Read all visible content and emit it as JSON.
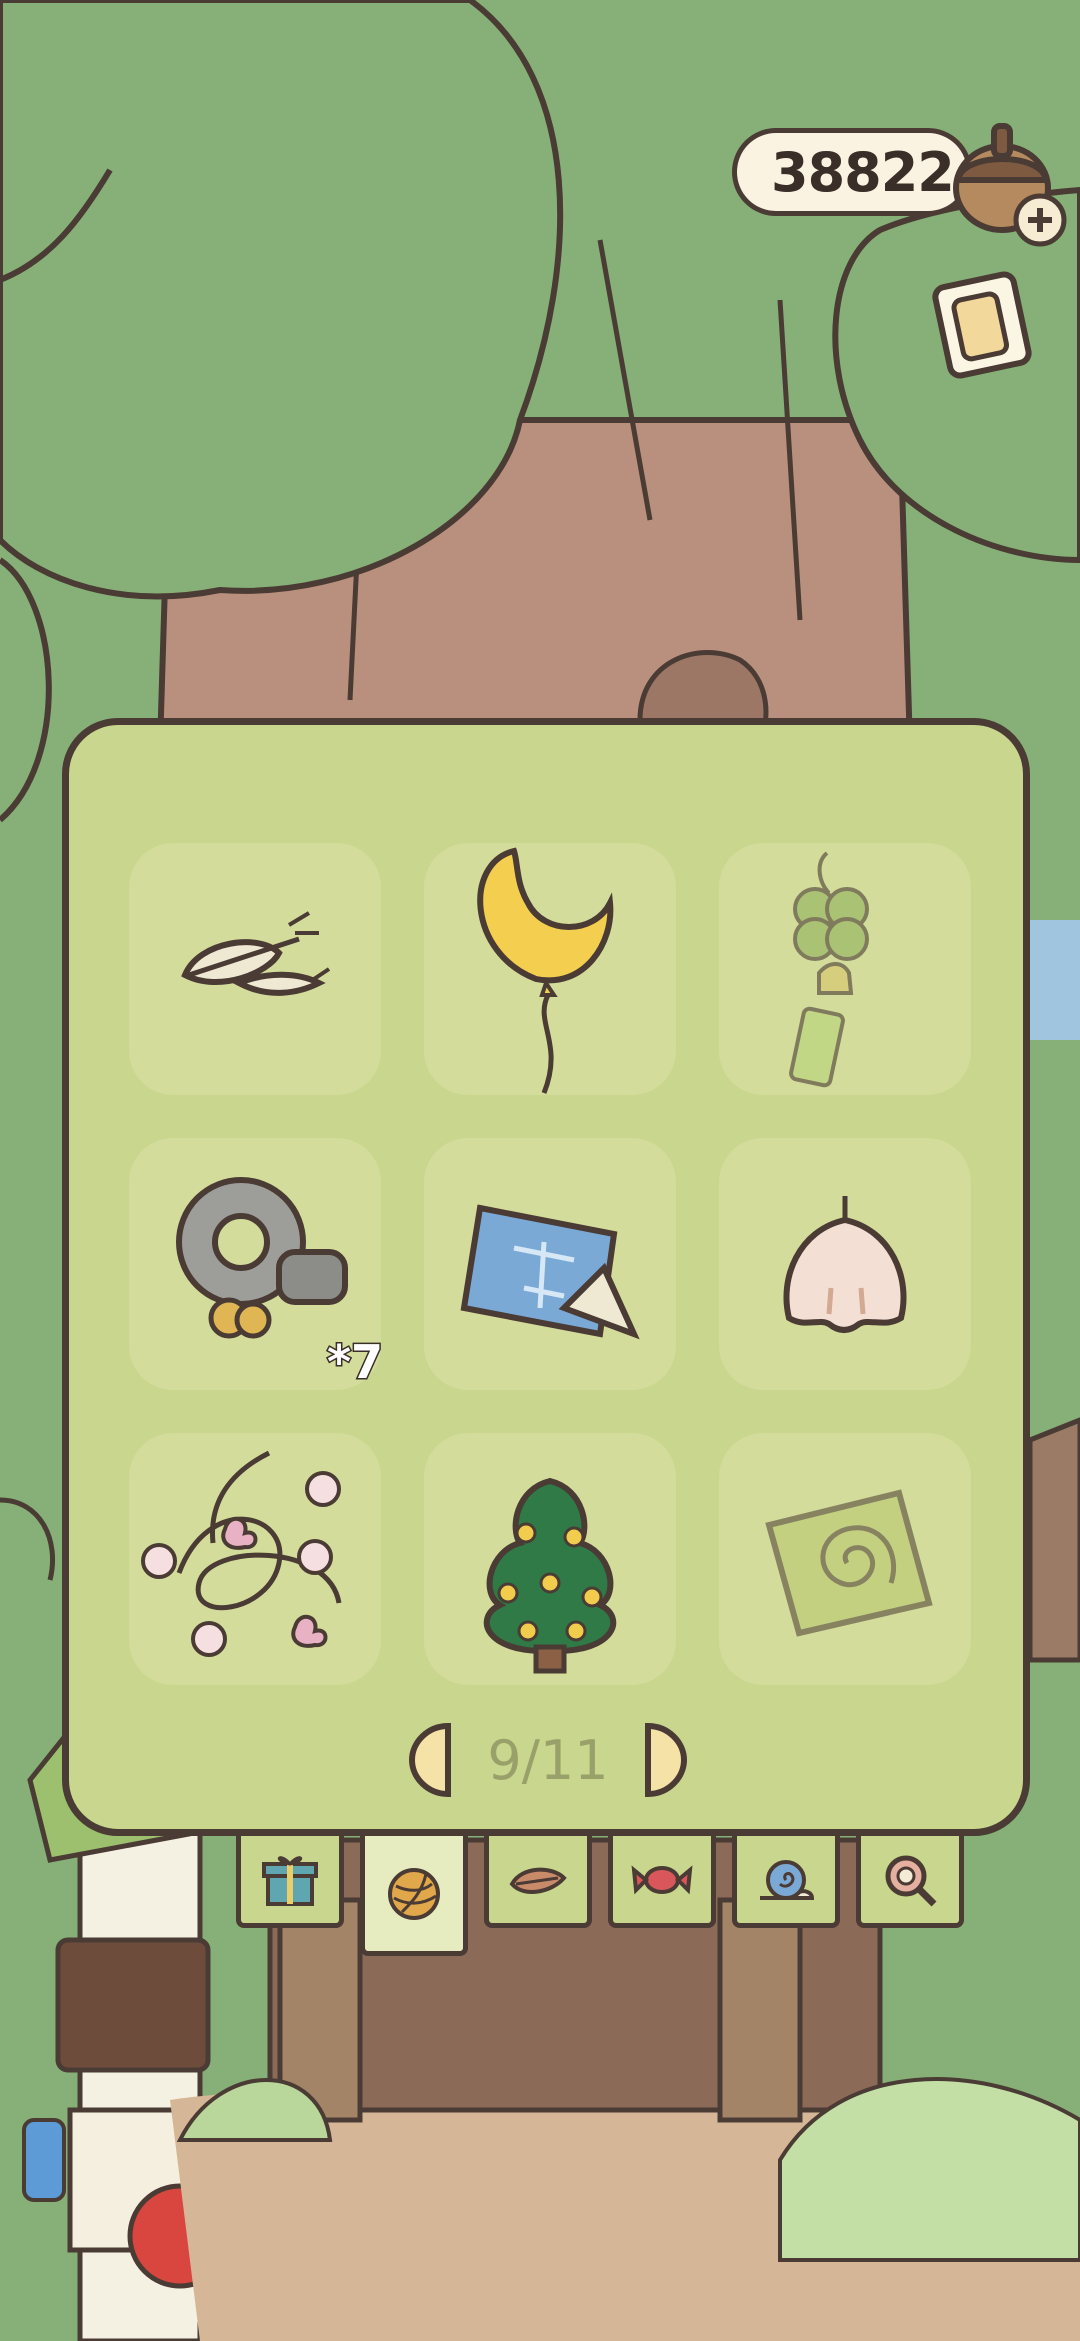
{
  "hud": {
    "currency_amount": "38822"
  },
  "panel": {
    "items": [
      {
        "name": "feather",
        "count": ""
      },
      {
        "name": "moon-balloon",
        "count": ""
      },
      {
        "name": "clover-charm",
        "count": ""
      },
      {
        "name": "gear-stones",
        "count": "*7"
      },
      {
        "name": "blueprint",
        "count": ""
      },
      {
        "name": "bell-flower",
        "count": ""
      },
      {
        "name": "flower-vine",
        "count": ""
      },
      {
        "name": "christmas-tree",
        "count": ""
      },
      {
        "name": "swirl-tile",
        "count": ""
      }
    ],
    "pager": {
      "page_text": "9/11"
    }
  },
  "tabs": [
    {
      "icon": "gift-icon"
    },
    {
      "icon": "yarn-icon"
    },
    {
      "icon": "leaf-icon"
    },
    {
      "icon": "candy-icon"
    },
    {
      "icon": "snail-icon"
    },
    {
      "icon": "magnifier-icon"
    }
  ],
  "colors": {
    "panel_bg": "#c9d68d",
    "slot_bg": "#d3dc9a",
    "outline": "#4a3b34",
    "foliage": "#86b077",
    "trunk": "#b9907d"
  }
}
